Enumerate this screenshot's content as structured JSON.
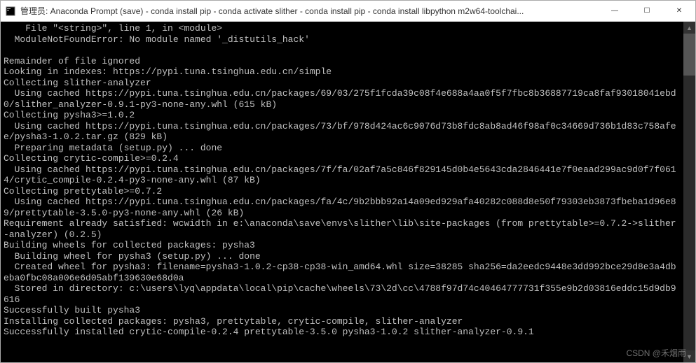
{
  "window": {
    "title": "管理员: Anaconda Prompt (save) - conda  install pip - conda  activate slither - conda  install pip - conda  install libpython m2w64-toolchai...",
    "controls": {
      "minimize": "—",
      "maximize": "☐",
      "close": "✕"
    }
  },
  "terminal": {
    "lines": [
      "    File \"<string>\", line 1, in <module>",
      "  ModuleNotFoundError: No module named '_distutils_hack'",
      "",
      "Remainder of file ignored",
      "Looking in indexes: https://pypi.tuna.tsinghua.edu.cn/simple",
      "Collecting slither-analyzer",
      "  Using cached https://pypi.tuna.tsinghua.edu.cn/packages/69/03/275f1fcda39c08f4e688a4aa0f5f7fbc8b36887719ca8faf93018041ebd0/slither_analyzer-0.9.1-py3-none-any.whl (615 kB)",
      "Collecting pysha3>=1.0.2",
      "  Using cached https://pypi.tuna.tsinghua.edu.cn/packages/73/bf/978d424ac6c9076d73b8fdc8ab8ad46f98af0c34669d736b1d83c758afee/pysha3-1.0.2.tar.gz (829 kB)",
      "  Preparing metadata (setup.py) ... done",
      "Collecting crytic-compile>=0.2.4",
      "  Using cached https://pypi.tuna.tsinghua.edu.cn/packages/7f/fa/02af7a5c846f829145d0b4e5643cda2846441e7f0eaad299ac9d0f7f0614/crytic_compile-0.2.4-py3-none-any.whl (87 kB)",
      "Collecting prettytable>=0.7.2",
      "  Using cached https://pypi.tuna.tsinghua.edu.cn/packages/fa/4c/9b2bbb92a14a09ed929afa40282c088d8e50f79303eb3873fbeba1d96e89/prettytable-3.5.0-py3-none-any.whl (26 kB)",
      "Requirement already satisfied: wcwidth in e:\\anaconda\\save\\envs\\slither\\lib\\site-packages (from prettytable>=0.7.2->slither-analyzer) (0.2.5)",
      "Building wheels for collected packages: pysha3",
      "  Building wheel for pysha3 (setup.py) ... done",
      "  Created wheel for pysha3: filename=pysha3-1.0.2-cp38-cp38-win_amd64.whl size=38285 sha256=da2eedc9448e3dd992bce29d8e3a4dbeba0fbc08a006e6d05abf139630e68d0a",
      "  Stored in directory: c:\\users\\lyq\\appdata\\local\\pip\\cache\\wheels\\73\\2d\\cc\\4788f97d74c40464777731f355e9b2d03816eddc15d9db9616",
      "Successfully built pysha3",
      "Installing collected packages: pysha3, prettytable, crytic-compile, slither-analyzer",
      "Successfully installed crytic-compile-0.2.4 prettytable-3.5.0 pysha3-1.0.2 slither-analyzer-0.9.1"
    ]
  },
  "watermark": "CSDN @禾烟雨"
}
